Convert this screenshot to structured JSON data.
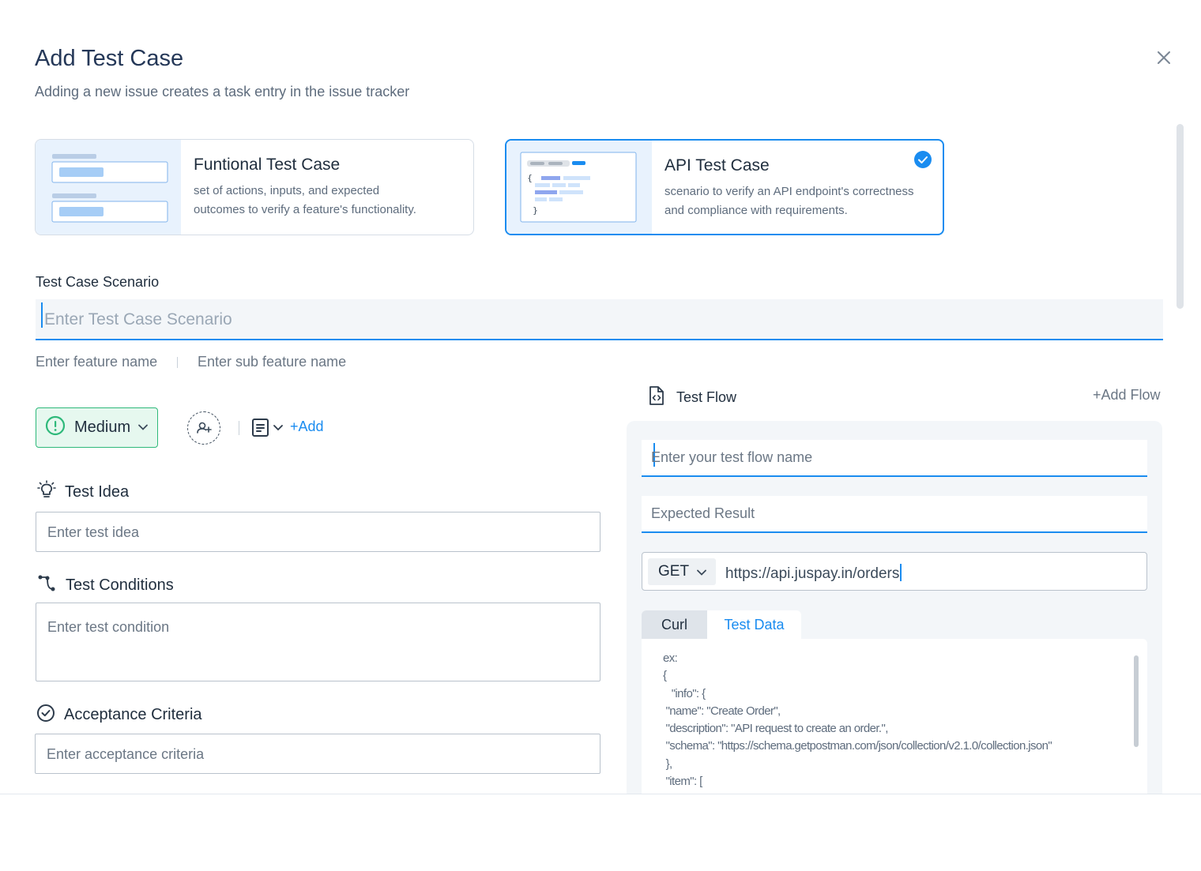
{
  "modal": {
    "title": "Add Test Case",
    "subtitle": "Adding a new issue creates a task entry in the issue tracker"
  },
  "case_types": [
    {
      "title": "Funtional Test Case",
      "description_line1": "set of actions, inputs, and expected",
      "description_line2": "outcomes to verify a feature's functionality.",
      "selected": false
    },
    {
      "title": "API Test Case",
      "description_line1": "scenario to verify an API endpoint's correctness",
      "description_line2": "and compliance with requirements.",
      "selected": true
    }
  ],
  "scenario": {
    "label": "Test Case Scenario",
    "placeholder": "Enter Test Case Scenario"
  },
  "feature": {
    "feature_placeholder": "Enter feature name",
    "sub_feature_placeholder": "Enter sub feature name"
  },
  "toolbar": {
    "priority": "Medium",
    "add_label": "+Add"
  },
  "test_idea": {
    "label": "Test Idea",
    "placeholder": "Enter test idea"
  },
  "test_conditions": {
    "label": "Test Conditions",
    "placeholder": "Enter test condition"
  },
  "acceptance": {
    "label": "Acceptance Criteria",
    "placeholder": "Enter acceptance criteria"
  },
  "test_flow": {
    "label": "Test Flow",
    "add_flow": "+Add Flow",
    "flow_name_placeholder": "Enter your test flow name",
    "expected_placeholder": "Expected Result",
    "method": "GET",
    "url": "https://api.juspay.in/orders",
    "tabs": [
      "Curl",
      "Test Data"
    ],
    "active_tab": "Test Data",
    "code_lines": [
      "ex:",
      "{",
      "   \"info\": {",
      " \"name\": \"Create Order\",",
      " \"description\": \"API request to create an order.\",",
      " \"schema\": \"https://schema.getpostman.com/json/collection/v2.1.0/collection.json\"",
      " },",
      " \"item\": ["
    ]
  },
  "colors": {
    "accent": "#1a8cf0",
    "priority_medium": "#2eb97a",
    "title_text": "#253858"
  },
  "icons": [
    "close-icon",
    "check-circle-icon",
    "alert-circle-icon",
    "chevron-down-icon",
    "assign-user-icon",
    "document-icon",
    "lightbulb-icon",
    "branch-icon",
    "check-outline-icon",
    "file-code-icon"
  ]
}
